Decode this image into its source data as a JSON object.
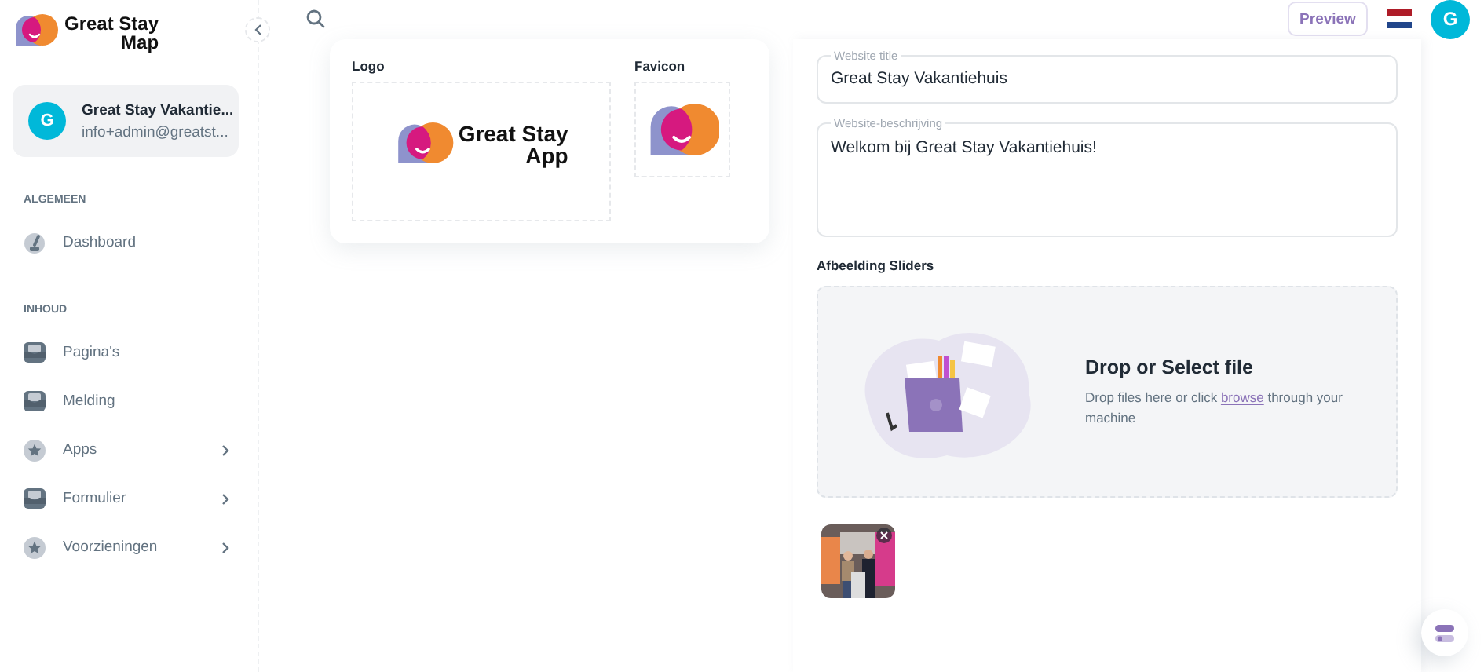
{
  "sidebar": {
    "brand": {
      "line_1": "Great Stay",
      "line_2": "Map"
    },
    "account": {
      "avatar": "G",
      "name": "Great Stay Vakantie...",
      "email": "info+admin@greatst..."
    },
    "sections": [
      {
        "heading": "ALGEMEEN",
        "items": [
          {
            "label": "Dashboard",
            "kind": "gauge",
            "expandable": false
          }
        ]
      },
      {
        "heading": "INHOUD",
        "items": [
          {
            "label": "Pagina's",
            "kind": "tray",
            "expandable": false
          },
          {
            "label": "Melding",
            "kind": "tray",
            "expandable": false
          },
          {
            "label": "Apps",
            "kind": "star",
            "expandable": true
          },
          {
            "label": "Formulier",
            "kind": "tray",
            "expandable": true
          },
          {
            "label": "Voorzieningen",
            "kind": "star",
            "expandable": true
          }
        ]
      }
    ]
  },
  "topbar": {
    "preview_button": "Preview",
    "avatar": "G"
  },
  "branding_card": {
    "logo": {
      "label": "Logo",
      "logo_text_1": "Great Stay",
      "logo_text_2": "App"
    },
    "favicon": {
      "label": "Favicon"
    }
  },
  "settings_form": {
    "fields": [
      {
        "label": "Website title",
        "value": "Great Stay Vakantiehuis",
        "kind": "input"
      },
      {
        "label": "Website-beschrijving",
        "value": "Welkom bij Great Stay Vakantiehuis!",
        "kind": "textarea"
      }
    ],
    "sliders_heading": "Afbeelding Sliders",
    "dropzone": {
      "title": "Drop or Select file",
      "text_before": "Drop files here or click",
      "link": "browse",
      "text_after": "through your machine"
    }
  }
}
